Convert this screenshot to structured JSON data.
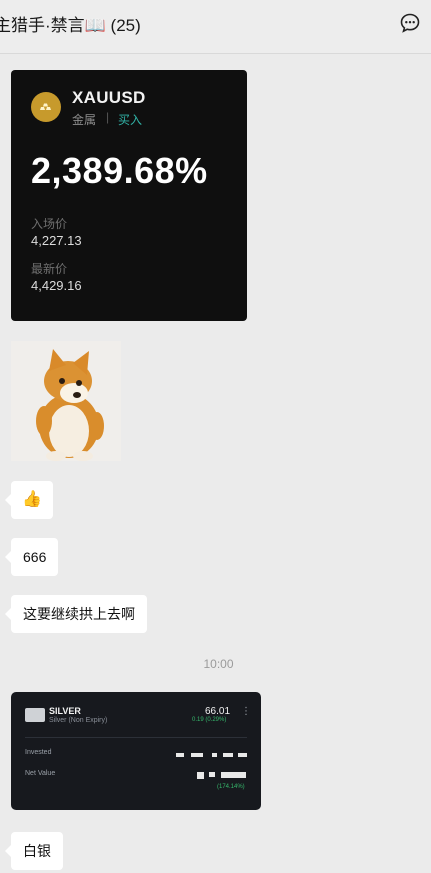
{
  "header": {
    "title": "主猎手·禁言📖 (25)",
    "more_icon": "chat-bubble-more-icon"
  },
  "trade_card": {
    "symbol": "XAUUSD",
    "category": "金属",
    "separator": "|",
    "side": "买入",
    "pnl_percent": "2,389.68%",
    "entry_label": "入场价",
    "entry_value": "4,227.13",
    "latest_label": "最新价",
    "latest_value": "4,429.16",
    "side_color": "#31b3a7",
    "coin_color": "#c79a2c"
  },
  "sticker": {
    "icon": "corgi-sticker"
  },
  "messages": {
    "thumb": "👍",
    "six": "666",
    "keep": "这要继续拱上去啊",
    "silver": "白银"
  },
  "time": {
    "label": "10:00"
  },
  "silver_card": {
    "name": "SILVER",
    "subtitle": "Silver (Non Expiry)",
    "price": "66.01",
    "change": "0.19 (0.29%)",
    "kebab": "⋮",
    "invested_label": "Invested",
    "net_value_label": "Net Value",
    "gain": "(174.14%)",
    "gain_color": "#36b86c"
  }
}
